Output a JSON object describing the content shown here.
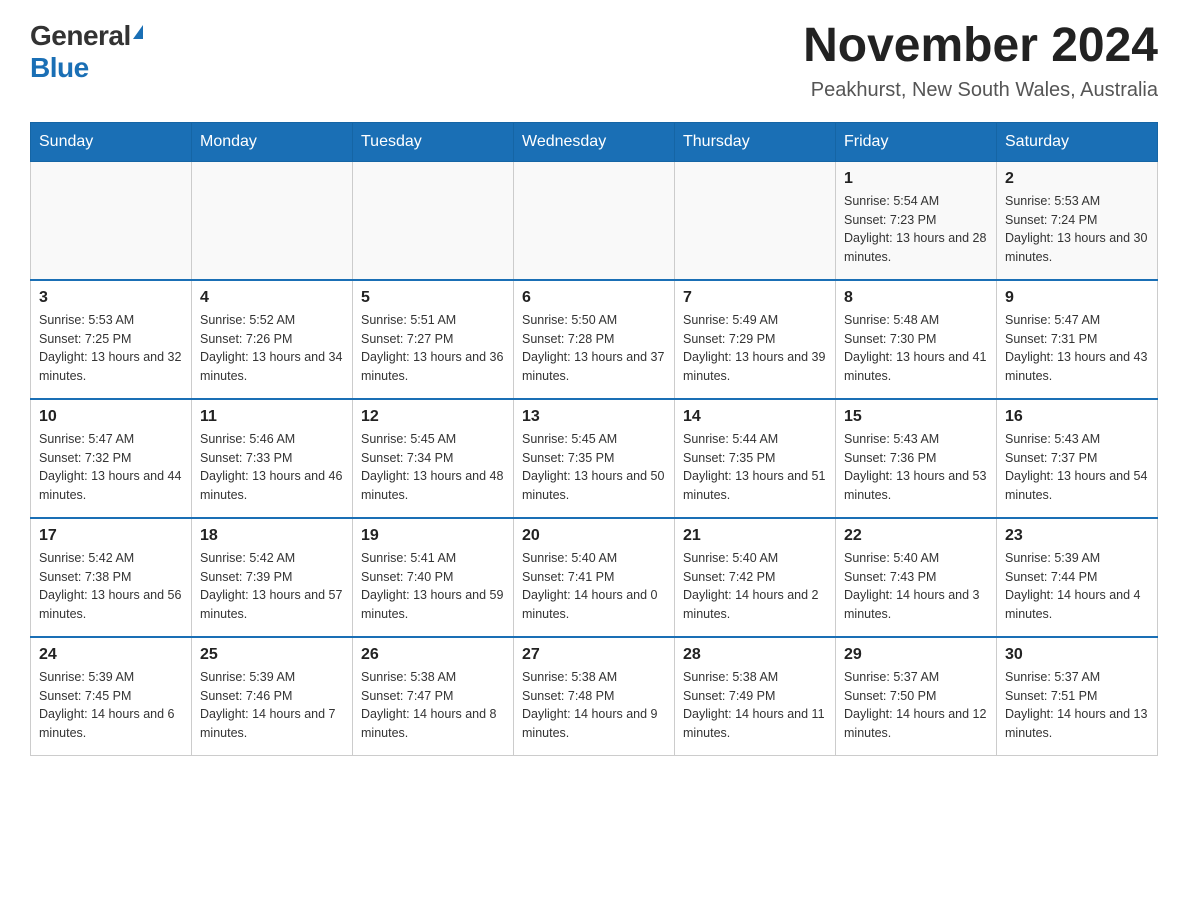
{
  "header": {
    "logo_general": "General",
    "logo_blue": "Blue",
    "month_title": "November 2024",
    "location": "Peakhurst, New South Wales, Australia"
  },
  "weekdays": [
    "Sunday",
    "Monday",
    "Tuesday",
    "Wednesday",
    "Thursday",
    "Friday",
    "Saturday"
  ],
  "weeks": [
    {
      "days": [
        {
          "number": "",
          "info": ""
        },
        {
          "number": "",
          "info": ""
        },
        {
          "number": "",
          "info": ""
        },
        {
          "number": "",
          "info": ""
        },
        {
          "number": "",
          "info": ""
        },
        {
          "number": "1",
          "info": "Sunrise: 5:54 AM\nSunset: 7:23 PM\nDaylight: 13 hours and 28 minutes."
        },
        {
          "number": "2",
          "info": "Sunrise: 5:53 AM\nSunset: 7:24 PM\nDaylight: 13 hours and 30 minutes."
        }
      ]
    },
    {
      "days": [
        {
          "number": "3",
          "info": "Sunrise: 5:53 AM\nSunset: 7:25 PM\nDaylight: 13 hours and 32 minutes."
        },
        {
          "number": "4",
          "info": "Sunrise: 5:52 AM\nSunset: 7:26 PM\nDaylight: 13 hours and 34 minutes."
        },
        {
          "number": "5",
          "info": "Sunrise: 5:51 AM\nSunset: 7:27 PM\nDaylight: 13 hours and 36 minutes."
        },
        {
          "number": "6",
          "info": "Sunrise: 5:50 AM\nSunset: 7:28 PM\nDaylight: 13 hours and 37 minutes."
        },
        {
          "number": "7",
          "info": "Sunrise: 5:49 AM\nSunset: 7:29 PM\nDaylight: 13 hours and 39 minutes."
        },
        {
          "number": "8",
          "info": "Sunrise: 5:48 AM\nSunset: 7:30 PM\nDaylight: 13 hours and 41 minutes."
        },
        {
          "number": "9",
          "info": "Sunrise: 5:47 AM\nSunset: 7:31 PM\nDaylight: 13 hours and 43 minutes."
        }
      ]
    },
    {
      "days": [
        {
          "number": "10",
          "info": "Sunrise: 5:47 AM\nSunset: 7:32 PM\nDaylight: 13 hours and 44 minutes."
        },
        {
          "number": "11",
          "info": "Sunrise: 5:46 AM\nSunset: 7:33 PM\nDaylight: 13 hours and 46 minutes."
        },
        {
          "number": "12",
          "info": "Sunrise: 5:45 AM\nSunset: 7:34 PM\nDaylight: 13 hours and 48 minutes."
        },
        {
          "number": "13",
          "info": "Sunrise: 5:45 AM\nSunset: 7:35 PM\nDaylight: 13 hours and 50 minutes."
        },
        {
          "number": "14",
          "info": "Sunrise: 5:44 AM\nSunset: 7:35 PM\nDaylight: 13 hours and 51 minutes."
        },
        {
          "number": "15",
          "info": "Sunrise: 5:43 AM\nSunset: 7:36 PM\nDaylight: 13 hours and 53 minutes."
        },
        {
          "number": "16",
          "info": "Sunrise: 5:43 AM\nSunset: 7:37 PM\nDaylight: 13 hours and 54 minutes."
        }
      ]
    },
    {
      "days": [
        {
          "number": "17",
          "info": "Sunrise: 5:42 AM\nSunset: 7:38 PM\nDaylight: 13 hours and 56 minutes."
        },
        {
          "number": "18",
          "info": "Sunrise: 5:42 AM\nSunset: 7:39 PM\nDaylight: 13 hours and 57 minutes."
        },
        {
          "number": "19",
          "info": "Sunrise: 5:41 AM\nSunset: 7:40 PM\nDaylight: 13 hours and 59 minutes."
        },
        {
          "number": "20",
          "info": "Sunrise: 5:40 AM\nSunset: 7:41 PM\nDaylight: 14 hours and 0 minutes."
        },
        {
          "number": "21",
          "info": "Sunrise: 5:40 AM\nSunset: 7:42 PM\nDaylight: 14 hours and 2 minutes."
        },
        {
          "number": "22",
          "info": "Sunrise: 5:40 AM\nSunset: 7:43 PM\nDaylight: 14 hours and 3 minutes."
        },
        {
          "number": "23",
          "info": "Sunrise: 5:39 AM\nSunset: 7:44 PM\nDaylight: 14 hours and 4 minutes."
        }
      ]
    },
    {
      "days": [
        {
          "number": "24",
          "info": "Sunrise: 5:39 AM\nSunset: 7:45 PM\nDaylight: 14 hours and 6 minutes."
        },
        {
          "number": "25",
          "info": "Sunrise: 5:39 AM\nSunset: 7:46 PM\nDaylight: 14 hours and 7 minutes."
        },
        {
          "number": "26",
          "info": "Sunrise: 5:38 AM\nSunset: 7:47 PM\nDaylight: 14 hours and 8 minutes."
        },
        {
          "number": "27",
          "info": "Sunrise: 5:38 AM\nSunset: 7:48 PM\nDaylight: 14 hours and 9 minutes."
        },
        {
          "number": "28",
          "info": "Sunrise: 5:38 AM\nSunset: 7:49 PM\nDaylight: 14 hours and 11 minutes."
        },
        {
          "number": "29",
          "info": "Sunrise: 5:37 AM\nSunset: 7:50 PM\nDaylight: 14 hours and 12 minutes."
        },
        {
          "number": "30",
          "info": "Sunrise: 5:37 AM\nSunset: 7:51 PM\nDaylight: 14 hours and 13 minutes."
        }
      ]
    }
  ]
}
